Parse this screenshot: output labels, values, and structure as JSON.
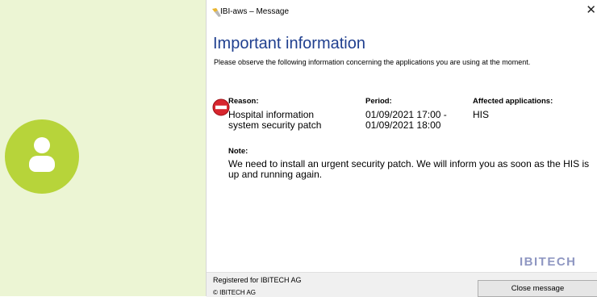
{
  "window": {
    "title": "IBI-aws – Message",
    "close_glyph": "✕"
  },
  "message": {
    "headline": "Important information",
    "subtitle": "Please observe the following information concerning the applications you are using at the moment.",
    "reason_label": "Reason:",
    "reason_value": "Hospital information system security patch",
    "period_label": "Period:",
    "period_value_line1": "01/09/2021 17:00 -",
    "period_value_line2": "01/09/2021 18:00",
    "apps_label": "Affected applications:",
    "apps_value": "HIS",
    "note_label": "Note:",
    "note_text": "We need to install an urgent security patch. We will inform you as soon as the HIS is up and running again."
  },
  "logo": {
    "text": "IBITECH"
  },
  "footer": {
    "registered": "Registered for IBITECH AG",
    "copyright": "© IBITECH AG",
    "close_button": "Close message"
  },
  "colors": {
    "left_pane_bg": "#ecf5d4",
    "avatar": "#b7d43a",
    "headline": "#1f3f8f",
    "stop_icon": "#d7262e"
  },
  "icons": {
    "avatar": "user-avatar-icon",
    "app": "app-icon",
    "reason": "stop-icon"
  }
}
